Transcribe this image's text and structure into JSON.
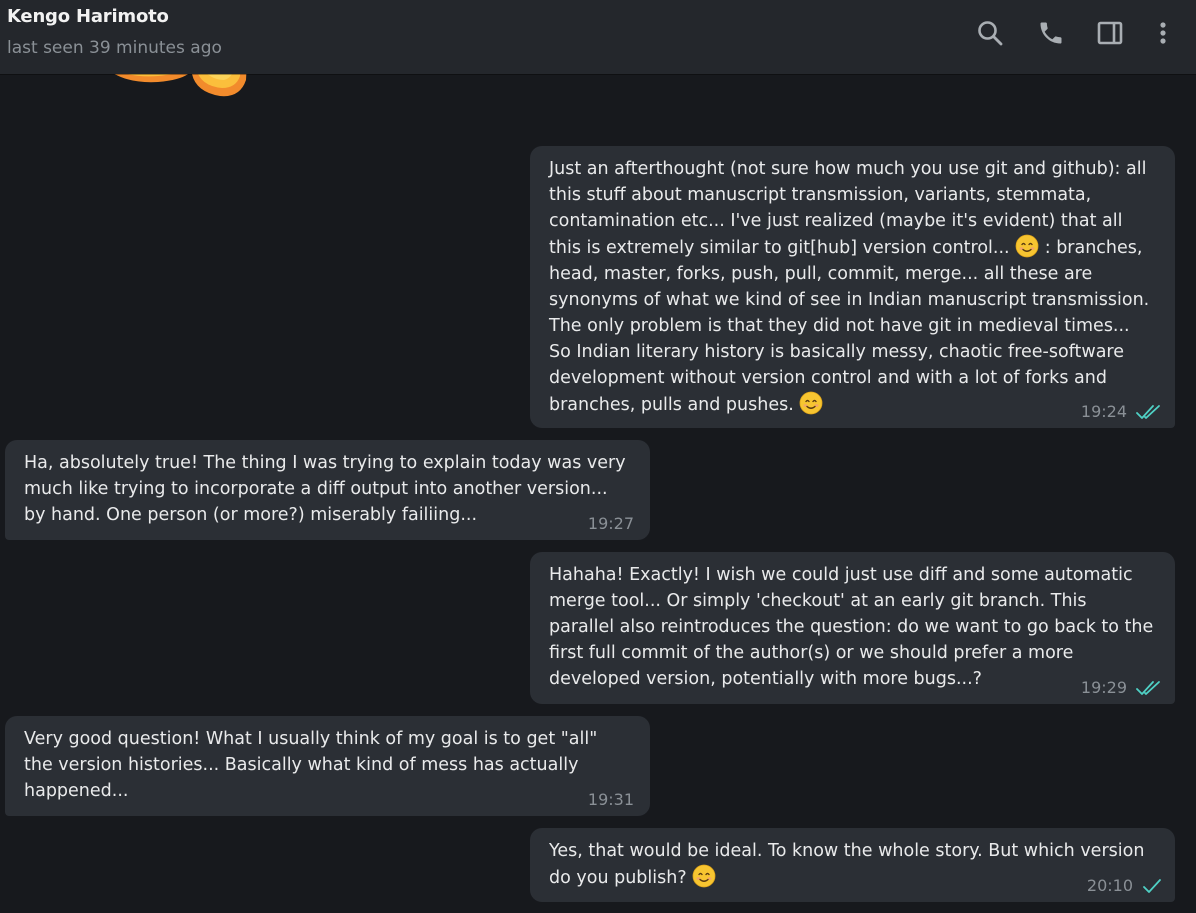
{
  "header": {
    "contact_name": "Kengo Harimoto",
    "status": "last seen 39 minutes ago",
    "actions": [
      "search-icon",
      "phone-icon",
      "sidebar-toggle-icon",
      "more-vertical-icon"
    ]
  },
  "colors": {
    "background": "#17191d",
    "header": "#24272c",
    "bubble": "#2b2f35",
    "read_check": "#4fd1c5",
    "text": "#e9eaeb",
    "muted": "#8a9096"
  },
  "messages": [
    {
      "direction": "outgoing",
      "parts": [
        "Just an afterthought (not sure how much you use git and github): all this stuff about manuscript transmission, variants, stemmata, contamination etc... I've just realized (maybe it's evident) that all this is extremely similar to git[hub] version control... ",
        " : branches, head, master, forks, push, pull, commit, merge... all these are synonyms of what we kind of see in Indian manuscript transmission. The only problem is that they did not have git in medieval times... So Indian literary history is basically messy, chaotic free-software development without version control and with a lot of forks and branches, pulls and pushes. "
      ],
      "time": "19:24",
      "status": "read"
    },
    {
      "direction": "incoming",
      "text": "Ha, absolutely true! The thing I was trying to explain today was very much like trying to incorporate a diff output into another version... by hand. One person (or more?) miserably failiing...",
      "time": "19:27"
    },
    {
      "direction": "outgoing",
      "text": "Hahaha! Exactly! I wish we could just use diff and some automatic merge tool... Or simply 'checkout' at an early git branch. This parallel also reintroduces the question: do we want to go back to the first full commit of the author(s) or we should prefer a more developed version, potentially with more bugs...?",
      "time": "19:29",
      "status": "read"
    },
    {
      "direction": "incoming",
      "text": "Very good question! What I usually think of my goal is to get \"all\" the version histories... Basically what kind of mess has actually happened...",
      "time": "19:31"
    },
    {
      "direction": "outgoing",
      "parts": [
        "Yes, that would be ideal. To know the whole story. But which version do you publish? "
      ],
      "time": "20:10",
      "status": "sent"
    }
  ]
}
